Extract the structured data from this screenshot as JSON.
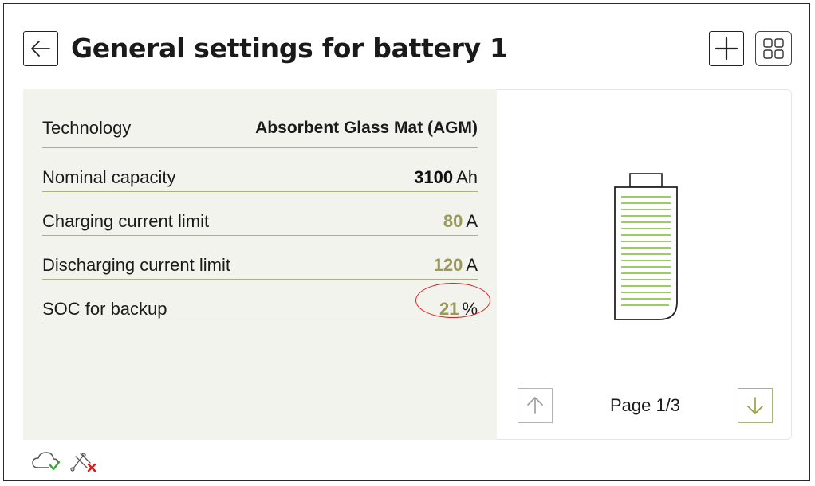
{
  "header": {
    "title": "General settings for battery 1",
    "back_icon": "arrow-left-icon",
    "add_icon": "plus-icon",
    "grid_icon": "grid-icon"
  },
  "settings": {
    "technology": {
      "label": "Technology",
      "value": "Absorbent Glass Mat (AGM)"
    },
    "nominal_capacity": {
      "label": "Nominal capacity",
      "value": "3100",
      "unit": "Ah"
    },
    "charging_current_limit": {
      "label": "Charging current limit",
      "value": "80",
      "unit": "A"
    },
    "discharging_current_limit": {
      "label": "Discharging current limit",
      "value": "120",
      "unit": "A"
    },
    "soc_for_backup": {
      "label": "SOC for backup",
      "value": "21",
      "unit": "%"
    }
  },
  "pager": {
    "label": "Page 1/3",
    "up_icon": "arrow-up-icon",
    "down_icon": "arrow-down-icon"
  },
  "status": {
    "cloud_icon": "cloud-check-icon",
    "connection_icon": "connection-error-icon"
  },
  "colors": {
    "accent_olive": "#9a9a58",
    "accent_green": "#7dbb2e",
    "panel_bg": "#f3f3ee",
    "annotation_red": "#e02020"
  }
}
